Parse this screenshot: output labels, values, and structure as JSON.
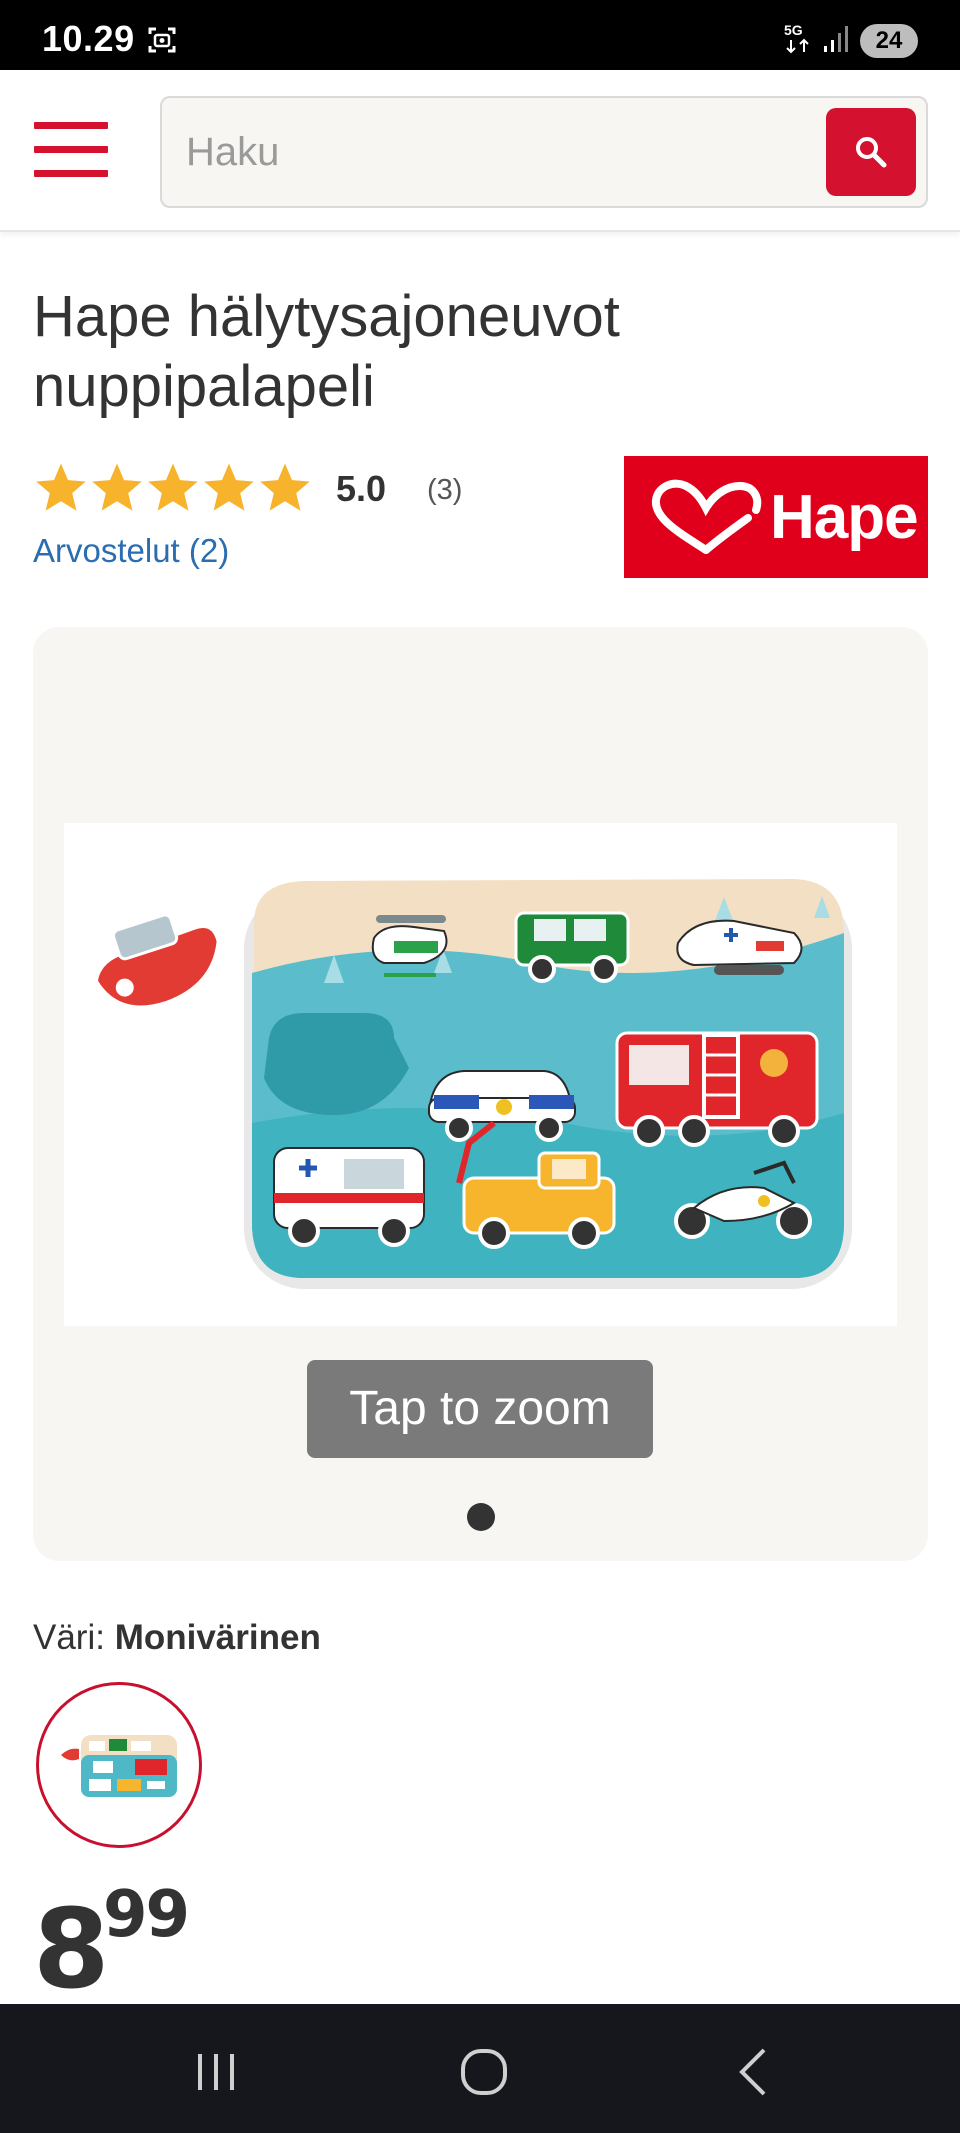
{
  "status_bar": {
    "time": "10.29",
    "network": "5G",
    "battery": "24",
    "icons": [
      "screenshot-icon",
      "5g-icon",
      "signal-icon",
      "battery-icon"
    ]
  },
  "header": {
    "menu_icon": "hamburger-menu-icon",
    "search": {
      "placeholder": "Haku",
      "value": ""
    },
    "search_icon": "search-icon",
    "accent_color": "#d4122f"
  },
  "product": {
    "title": "Hape hälytysajoneuvot nuppipalapeli",
    "rating": {
      "stars_filled": 5,
      "stars_total": 5,
      "value": "5.0",
      "count": "(3)"
    },
    "reviews_link": "Arvostelut (2)",
    "brand_logo_text": "Hape",
    "brand_color": "#e0001b"
  },
  "gallery": {
    "zoom_hint": "Tap to zoom",
    "image_count": 1,
    "active_index": 0
  },
  "variant": {
    "label": "Väri:",
    "selected": "Monivärinen"
  },
  "price": {
    "integer": "8",
    "decimals": "99"
  },
  "nav_bar": {
    "icons": [
      "recent-apps-icon",
      "home-icon",
      "back-icon"
    ]
  }
}
